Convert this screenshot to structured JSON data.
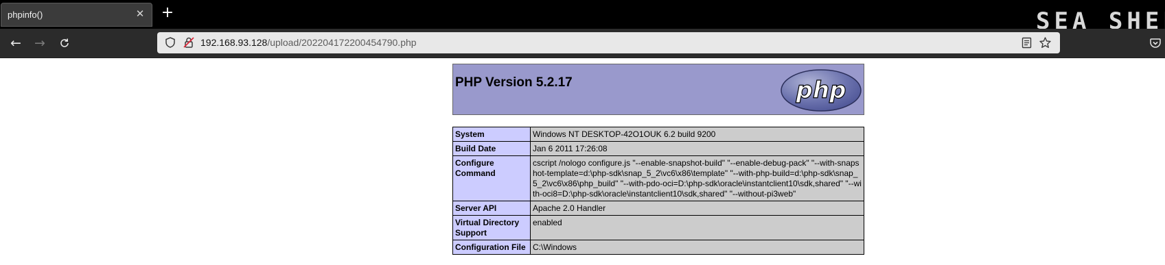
{
  "tab": {
    "title": "phpinfo()"
  },
  "brand": {
    "text": "SEA SHEPH"
  },
  "address_bar": {
    "host": "192.168.93.128",
    "path": "/upload/202204172200454790.php"
  },
  "icons": {
    "close": "close-icon",
    "new_tab": "plus-icon",
    "back": "arrow-left-icon",
    "forward": "arrow-right-icon",
    "reload": "reload-icon",
    "shield": "shield-icon",
    "insecure_lock": "insecure-lock-icon",
    "reader_view": "reader-view-icon",
    "bookmark": "star-icon",
    "pocket": "pocket-icon"
  },
  "colors": {
    "header_bg": "#9999cc",
    "label_bg": "#ccccff",
    "value_bg": "#cccccc"
  },
  "phpinfo": {
    "version_title": "PHP Version 5.2.17",
    "logo_text": "php",
    "rows": [
      {
        "label": "System",
        "value": "Windows NT DESKTOP-42O1OUK 6.2 build 9200"
      },
      {
        "label": "Build Date",
        "value": "Jan 6 2011 17:26:08"
      },
      {
        "label": "Configure Command",
        "value": "cscript /nologo configure.js \"--enable-snapshot-build\" \"--enable-debug-pack\" \"--with-snapshot-template=d:\\php-sdk\\snap_5_2\\vc6\\x86\\template\" \"--with-php-build=d:\\php-sdk\\snap_5_2\\vc6\\x86\\php_build\" \"--with-pdo-oci=D:\\php-sdk\\oracle\\instantclient10\\sdk,shared\" \"--with-oci8=D:\\php-sdk\\oracle\\instantclient10\\sdk,shared\" \"--without-pi3web\""
      },
      {
        "label": "Server API",
        "value": "Apache 2.0 Handler"
      },
      {
        "label": "Virtual Directory Support",
        "value": "enabled"
      },
      {
        "label": "Configuration File",
        "value": "C:\\Windows"
      }
    ]
  }
}
